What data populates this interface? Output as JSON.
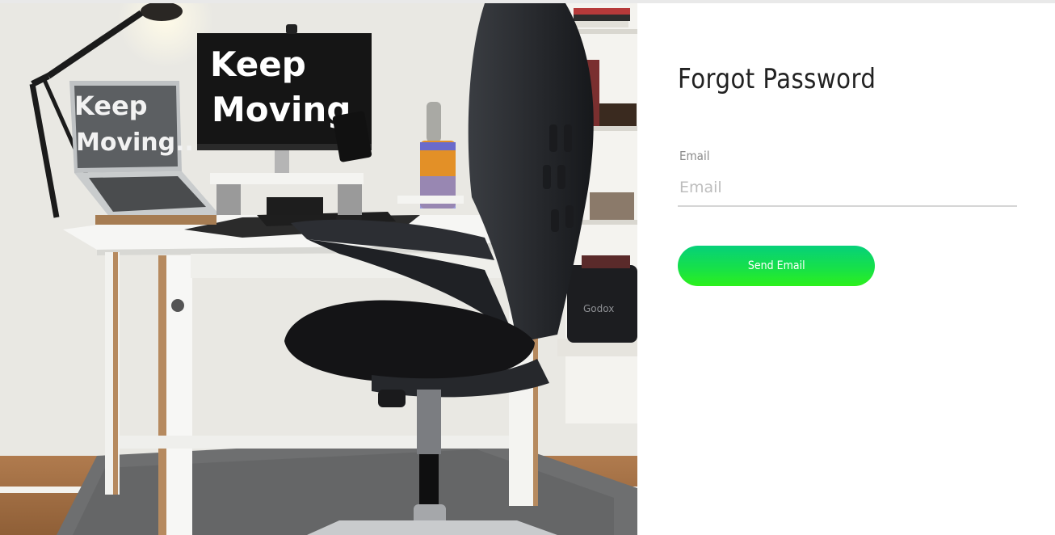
{
  "photo": {
    "laptop_screen_text": [
      "Keep",
      "Moving.."
    ],
    "monitor_screen_text": [
      "Keep",
      "Moving."
    ],
    "bag_brand": "Godox"
  },
  "form": {
    "title": "Forgot Password",
    "email_label": "Email",
    "email_placeholder": "Email",
    "email_value": "",
    "submit_label": "Send Email",
    "button_colors": [
      "#06d07a",
      "#2cf01c"
    ]
  }
}
